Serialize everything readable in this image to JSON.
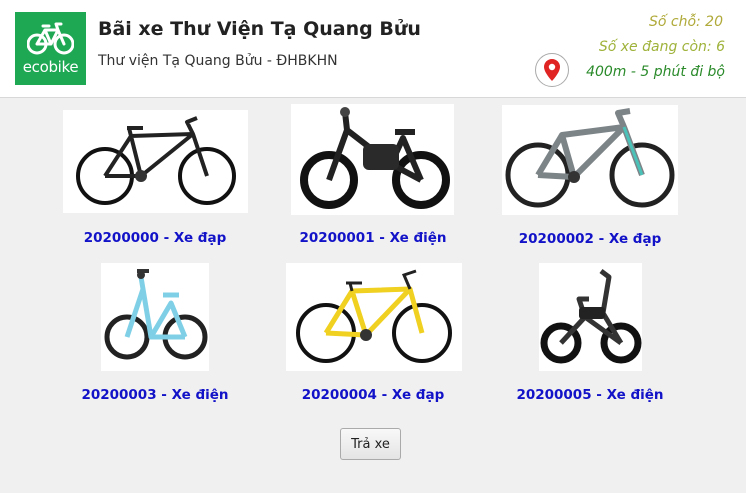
{
  "header": {
    "logo_text": "ecobike",
    "title": "Bãi xe Thư Viện Tạ Quang Bửu",
    "subtitle": "Thư viện Tạ Quang Bửu - ĐHBKHN",
    "slots": "Số chỗ: 20",
    "remaining": "Số xe đang còn: 6",
    "distance": "400m - 5 phút đi bộ"
  },
  "bikes": [
    {
      "label": "20200000 - Xe đạp"
    },
    {
      "label": "20200001 - Xe điện"
    },
    {
      "label": "20200002 - Xe đạp"
    },
    {
      "label": "20200003 - Xe điện"
    },
    {
      "label": "20200004 - Xe đạp"
    },
    {
      "label": "20200005 - Xe điện"
    }
  ],
  "actions": {
    "return_label": "Trả xe"
  },
  "colors": {
    "brand_green": "#1ea854",
    "label_blue": "#1212c8",
    "pin_red": "#e02424"
  }
}
